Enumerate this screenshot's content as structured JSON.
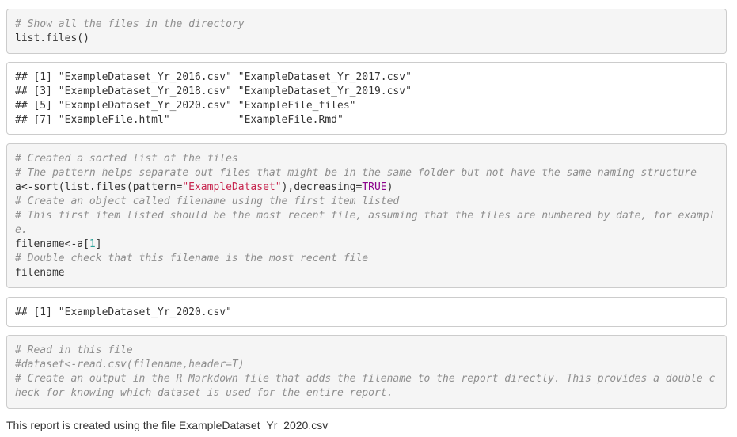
{
  "block1": {
    "comment": "# Show all the files in the directory",
    "code": "list.files()"
  },
  "output1": {
    "lines": [
      "## [1] \"ExampleDataset_Yr_2016.csv\" \"ExampleDataset_Yr_2017.csv\"",
      "## [3] \"ExampleDataset_Yr_2018.csv\" \"ExampleDataset_Yr_2019.csv\"",
      "## [5] \"ExampleDataset_Yr_2020.csv\" \"ExampleFile_files\"",
      "## [7] \"ExampleFile.html\"           \"ExampleFile.Rmd\""
    ]
  },
  "block2": {
    "comment1": "# Created a sorted list of the files",
    "comment2": "# The pattern helps separate out files that might be in the same folder but not have the same naming structure",
    "code1_a": "a<-sort(list.files(pattern=",
    "code1_str": "\"ExampleDataset\"",
    "code1_b": "),decreasing=",
    "code1_kw": "TRUE",
    "code1_c": ")",
    "comment3": "# Create an object called filename using the first item listed",
    "comment4": "# This first item listed should be the most recent file, assuming that the files are numbered by date, for exampl",
    "comment4_wrap": "e.",
    "code2_a": "filename<-a[",
    "code2_num": "1",
    "code2_b": "]",
    "comment5": "# Double check that this filename is the most recent file",
    "code3": "filename"
  },
  "output2": {
    "line": "## [1] \"ExampleDataset_Yr_2020.csv\""
  },
  "block3": {
    "comment1": "# Read in this file",
    "comment2": "#dataset<-read.csv(filename,header=T)",
    "comment3": "# Create an output in the R Markdown file that adds the filename to the report directly. This provides a double c",
    "comment3_wrap": "heck for knowing which dataset is used for the entire report."
  },
  "footer": {
    "text": "This report is created using the file ExampleDataset_Yr_2020.csv"
  }
}
